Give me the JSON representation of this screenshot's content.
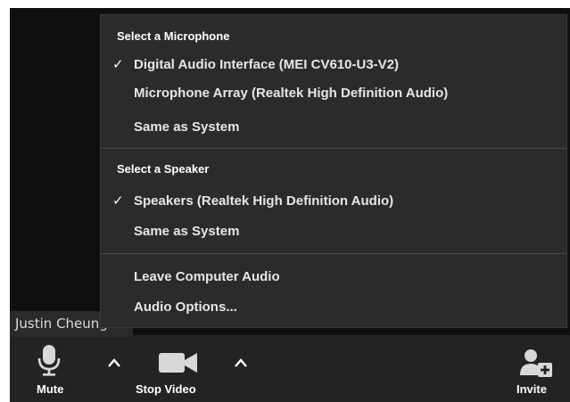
{
  "participant": {
    "name": "Justin Cheung"
  },
  "audio_menu": {
    "microphone_header": "Select a Microphone",
    "microphones": [
      {
        "label": "Digital Audio Interface (MEI CV610-U3-V2)",
        "selected": true
      },
      {
        "label": "Microphone Array (Realtek High Definition Audio)",
        "selected": false
      },
      {
        "label": "Same as System",
        "selected": false
      }
    ],
    "speaker_header": "Select a Speaker",
    "speakers": [
      {
        "label": "Speakers (Realtek High Definition Audio)",
        "selected": true
      },
      {
        "label": "Same as System",
        "selected": false
      }
    ],
    "leave_audio": "Leave Computer Audio",
    "audio_options": "Audio Options...",
    "check_glyph": "✓"
  },
  "toolbar": {
    "mute_label": "Mute",
    "stop_video_label": "Stop Video",
    "invite_label": "Invite"
  },
  "icons": {
    "microphone": "microphone-icon",
    "video_camera": "video-camera-icon",
    "invite": "add-participant-icon",
    "chevron": "chevron-up-icon"
  },
  "colors": {
    "menu_bg": "#2b2b2b",
    "toolbar_bg": "#232323",
    "video_bg": "#0f0f0f",
    "text": "#e6e6e6"
  }
}
